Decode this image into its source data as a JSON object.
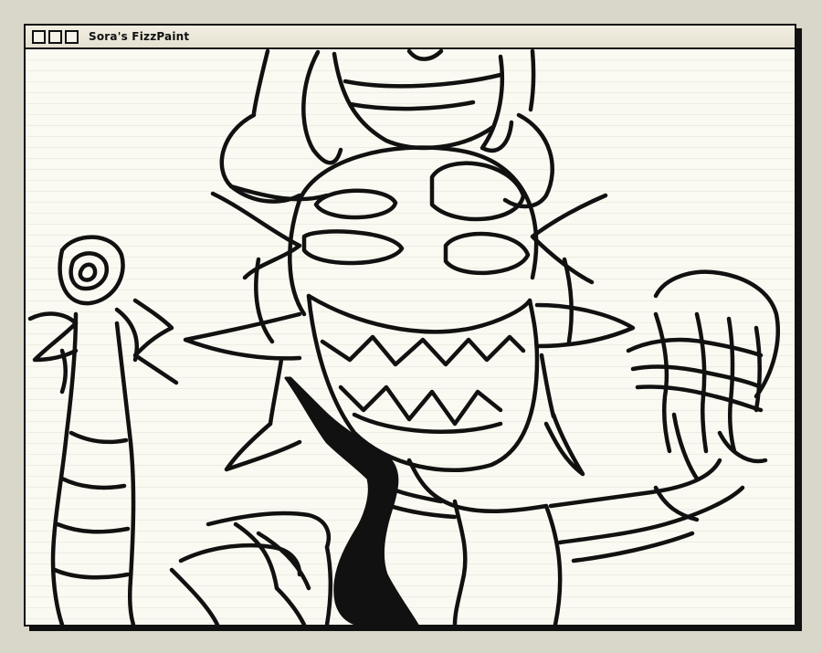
{
  "window": {
    "title": "Sora's FizzPaint",
    "controls": [
      "window-control",
      "window-control",
      "window-control"
    ]
  },
  "canvas": {
    "content": "line drawing",
    "background_color": "#fbfaf2",
    "stroke_color": "#111111"
  }
}
